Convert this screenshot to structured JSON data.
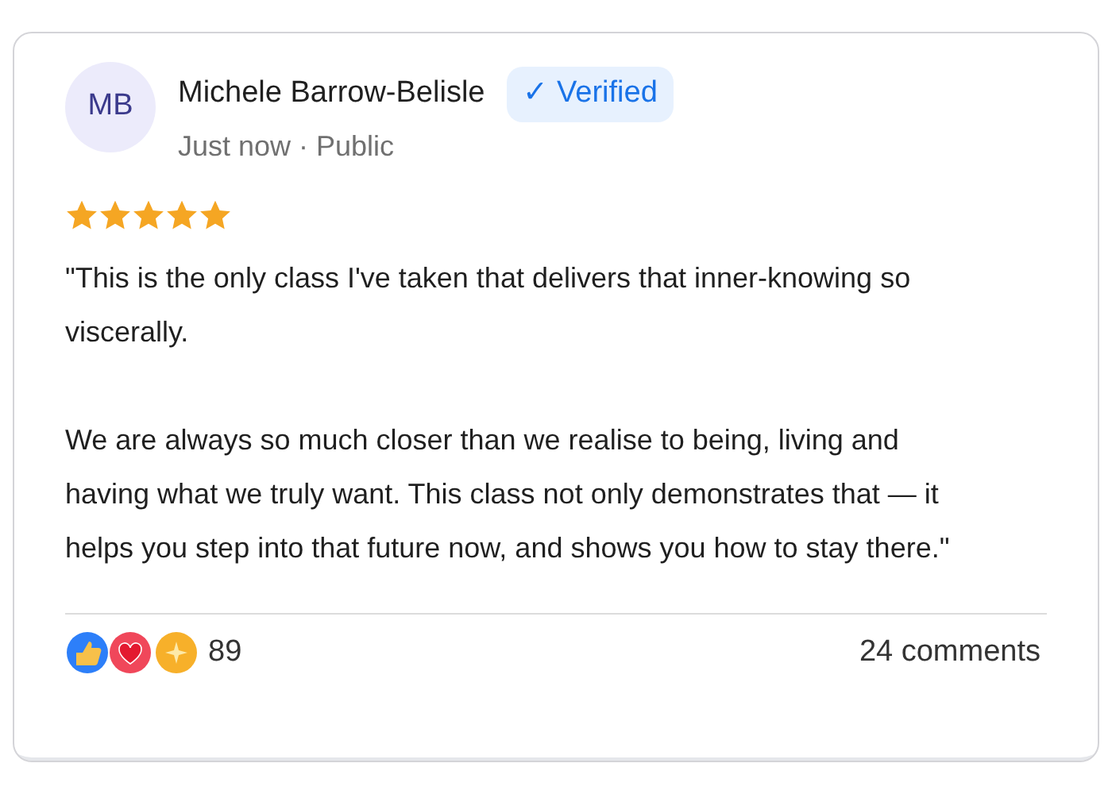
{
  "author": {
    "initials": "MB",
    "name": "Michele Barrow-Belisle",
    "badge": "✓ Verified",
    "meta": "Just now · Public"
  },
  "rating": {
    "stars": 5
  },
  "paragraphs": [
    "\"This is the only class I've taken that delivers that inner-knowing so viscerally.",
    "We are always so much closer than we realise to being, living and having what we truly want. This class not only demonstrates that — it helps you step into that future now, and shows you how to stay there.\""
  ],
  "footer": {
    "reaction_count": "89",
    "comments": "24 comments"
  }
}
